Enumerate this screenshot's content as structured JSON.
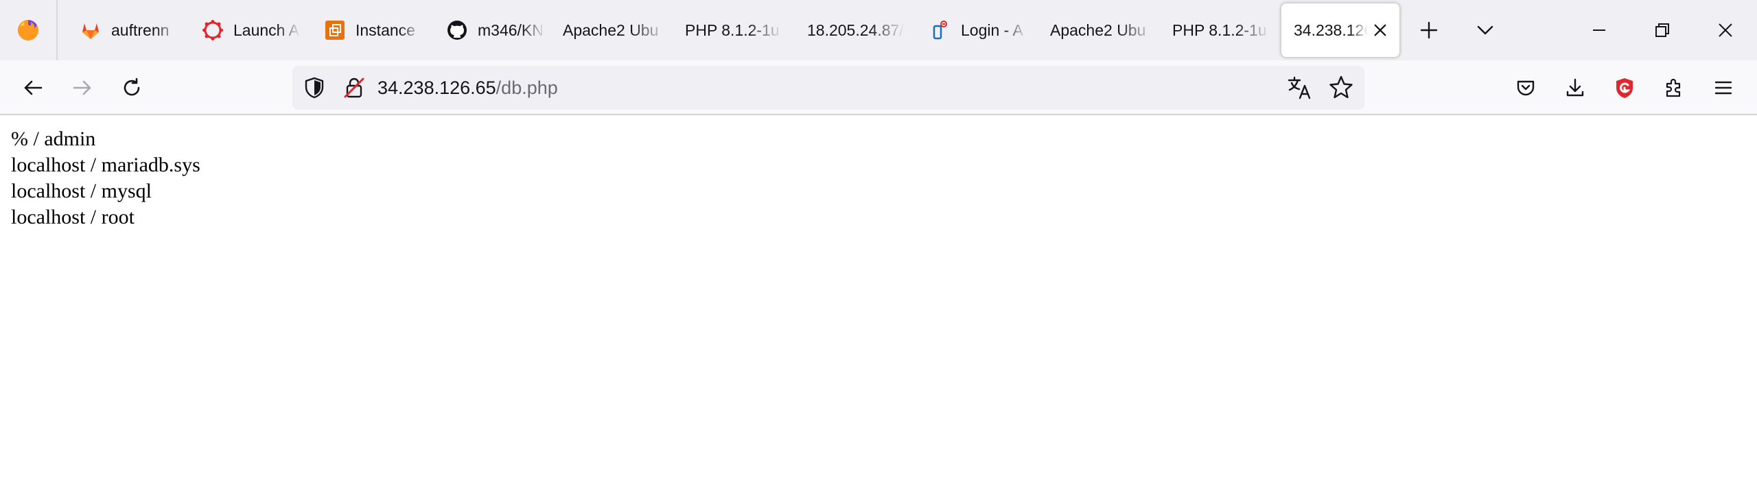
{
  "tabs": [
    {
      "label": "auftrenn",
      "icon": "gitlab-icon"
    },
    {
      "label": "Launch A",
      "icon": "canvas-icon"
    },
    {
      "label": "Instance",
      "icon": "aws-icon"
    },
    {
      "label": "m346/KN",
      "icon": "github-icon"
    },
    {
      "label": "Apache2 Ubu",
      "icon": ""
    },
    {
      "label": "PHP 8.1.2-1u",
      "icon": ""
    },
    {
      "label": "18.205.24.87/",
      "icon": ""
    },
    {
      "label": "Login - A",
      "icon": "phpmyadmin-icon"
    },
    {
      "label": "Apache2 Ubu",
      "icon": ""
    },
    {
      "label": "PHP 8.1.2-1u",
      "icon": ""
    },
    {
      "label": "34.238.126",
      "icon": "",
      "active": true
    }
  ],
  "url": {
    "host": "34.238.126.65",
    "path": "/db.php"
  },
  "content_lines": [
    "% / admin",
    "localhost / mariadb.sys",
    "localhost / mysql",
    "localhost / root"
  ],
  "colors": {
    "tabstrip": "#f0f0f4",
    "toolbar": "#f9f9fb",
    "accent_red": "#e3262e"
  }
}
